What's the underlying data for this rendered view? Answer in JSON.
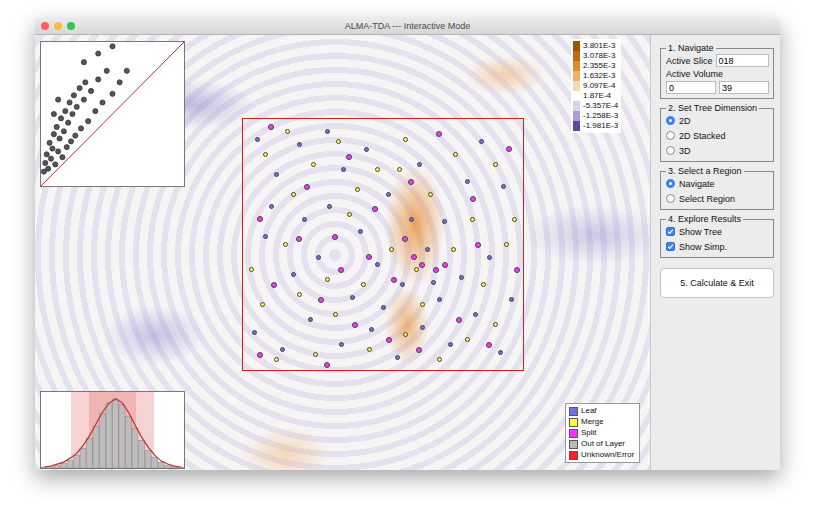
{
  "window": {
    "title": "ALMA-TDA --- Interactive Mode"
  },
  "colorbar": {
    "ticks": [
      {
        "label": "3.801E-3",
        "color": "#a0500a"
      },
      {
        "label": "3.078E-3",
        "color": "#c46a14"
      },
      {
        "label": "2.355E-3",
        "color": "#e08a30"
      },
      {
        "label": "1.632E-3",
        "color": "#f0b070"
      },
      {
        "label": "9.097E-4",
        "color": "#f8d8b0"
      },
      {
        "label": "1.87E-4",
        "color": "#ffffff"
      },
      {
        "label": "-5.357E-4",
        "color": "#d8d4ec"
      },
      {
        "label": "-1.258E-3",
        "color": "#a8a0d4"
      },
      {
        "label": "-1.981E-3",
        "color": "#5a4a98"
      }
    ]
  },
  "legend": [
    {
      "label": "Leaf",
      "kind": "leaf",
      "color": "#7070e8"
    },
    {
      "label": "Merge",
      "kind": "merge",
      "color": "#ffff33"
    },
    {
      "label": "Split",
      "kind": "split",
      "color": "#ff33ff"
    },
    {
      "label": "Out of Layer",
      "kind": "out",
      "color": "#bbbbbb"
    },
    {
      "label": "Unknown/Error",
      "kind": "error",
      "color": "#ff2222"
    }
  ],
  "persistence_diagram": {
    "points": [
      [
        0.02,
        0.1
      ],
      [
        0.03,
        0.16
      ],
      [
        0.04,
        0.22
      ],
      [
        0.05,
        0.12
      ],
      [
        0.06,
        0.3
      ],
      [
        0.07,
        0.19
      ],
      [
        0.08,
        0.26
      ],
      [
        0.09,
        0.36
      ],
      [
        0.1,
        0.15
      ],
      [
        0.11,
        0.41
      ],
      [
        0.12,
        0.24
      ],
      [
        0.13,
        0.33
      ],
      [
        0.14,
        0.47
      ],
      [
        0.15,
        0.2
      ],
      [
        0.16,
        0.38
      ],
      [
        0.17,
        0.52
      ],
      [
        0.18,
        0.27
      ],
      [
        0.19,
        0.44
      ],
      [
        0.2,
        0.58
      ],
      [
        0.21,
        0.31
      ],
      [
        0.22,
        0.5
      ],
      [
        0.23,
        0.63
      ],
      [
        0.24,
        0.35
      ],
      [
        0.25,
        0.55
      ],
      [
        0.27,
        0.68
      ],
      [
        0.28,
        0.4
      ],
      [
        0.3,
        0.6
      ],
      [
        0.31,
        0.72
      ],
      [
        0.33,
        0.45
      ],
      [
        0.35,
        0.66
      ],
      [
        0.38,
        0.52
      ],
      [
        0.4,
        0.74
      ],
      [
        0.43,
        0.58
      ],
      [
        0.46,
        0.8
      ],
      [
        0.5,
        0.64
      ],
      [
        0.55,
        0.72
      ],
      [
        0.6,
        0.8
      ],
      [
        0.4,
        0.92
      ],
      [
        0.3,
        0.86
      ],
      [
        0.5,
        0.97
      ],
      [
        0.12,
        0.6
      ],
      [
        0.09,
        0.5
      ]
    ]
  },
  "histogram": {
    "bars": [
      1,
      2,
      3,
      5,
      8,
      13,
      20,
      30,
      42,
      55,
      66,
      70,
      64,
      52,
      40,
      28,
      18,
      11,
      6,
      3,
      2,
      1
    ],
    "curve": [
      1,
      2,
      4,
      6,
      10,
      15,
      23,
      33,
      45,
      57,
      66,
      70,
      66,
      56,
      43,
      31,
      21,
      13,
      7,
      4,
      2,
      1
    ]
  },
  "region": {
    "critical_points": [
      {
        "kind": "leaf",
        "points": [
          [
            0.05,
            0.08
          ],
          [
            0.12,
            0.22
          ],
          [
            0.2,
            0.1
          ],
          [
            0.31,
            0.35
          ],
          [
            0.44,
            0.12
          ],
          [
            0.52,
            0.3
          ],
          [
            0.63,
            0.18
          ],
          [
            0.72,
            0.41
          ],
          [
            0.85,
            0.09
          ],
          [
            0.93,
            0.27
          ],
          [
            0.08,
            0.47
          ],
          [
            0.18,
            0.62
          ],
          [
            0.27,
            0.55
          ],
          [
            0.39,
            0.71
          ],
          [
            0.48,
            0.58
          ],
          [
            0.57,
            0.66
          ],
          [
            0.66,
            0.52
          ],
          [
            0.78,
            0.63
          ],
          [
            0.88,
            0.55
          ],
          [
            0.96,
            0.72
          ],
          [
            0.04,
            0.85
          ],
          [
            0.14,
            0.92
          ],
          [
            0.24,
            0.8
          ],
          [
            0.35,
            0.9
          ],
          [
            0.46,
            0.84
          ],
          [
            0.55,
            0.95
          ],
          [
            0.64,
            0.83
          ],
          [
            0.74,
            0.9
          ],
          [
            0.83,
            0.78
          ],
          [
            0.92,
            0.93
          ],
          [
            0.1,
            0.35
          ],
          [
            0.36,
            0.2
          ],
          [
            0.6,
            0.4
          ],
          [
            0.8,
            0.25
          ],
          [
            0.42,
            0.45
          ],
          [
            0.7,
            0.72
          ],
          [
            0.22,
            0.4
          ],
          [
            0.5,
            0.75
          ],
          [
            0.68,
            0.65
          ],
          [
            0.3,
            0.05
          ]
        ]
      },
      {
        "kind": "merge",
        "points": [
          [
            0.08,
            0.14
          ],
          [
            0.16,
            0.05
          ],
          [
            0.25,
            0.18
          ],
          [
            0.34,
            0.09
          ],
          [
            0.41,
            0.28
          ],
          [
            0.58,
            0.08
          ],
          [
            0.67,
            0.3
          ],
          [
            0.76,
            0.14
          ],
          [
            0.9,
            0.18
          ],
          [
            0.97,
            0.4
          ],
          [
            0.03,
            0.6
          ],
          [
            0.15,
            0.5
          ],
          [
            0.3,
            0.64
          ],
          [
            0.43,
            0.66
          ],
          [
            0.53,
            0.52
          ],
          [
            0.62,
            0.6
          ],
          [
            0.75,
            0.52
          ],
          [
            0.86,
            0.66
          ],
          [
            0.94,
            0.5
          ],
          [
            0.07,
            0.74
          ],
          [
            0.2,
            0.7
          ],
          [
            0.33,
            0.78
          ],
          [
            0.45,
            0.92
          ],
          [
            0.58,
            0.86
          ],
          [
            0.7,
            0.96
          ],
          [
            0.8,
            0.88
          ],
          [
            0.9,
            0.82
          ],
          [
            0.12,
            0.96
          ],
          [
            0.26,
            0.94
          ],
          [
            0.38,
            0.38
          ],
          [
            0.56,
            0.2
          ],
          [
            0.82,
            0.4
          ],
          [
            0.64,
            0.74
          ],
          [
            0.18,
            0.3
          ],
          [
            0.48,
            0.2
          ]
        ]
      },
      {
        "kind": "split",
        "points": [
          [
            0.1,
            0.03
          ],
          [
            0.23,
            0.27
          ],
          [
            0.38,
            0.15
          ],
          [
            0.47,
            0.36
          ],
          [
            0.6,
            0.25
          ],
          [
            0.7,
            0.06
          ],
          [
            0.82,
            0.32
          ],
          [
            0.95,
            0.12
          ],
          [
            0.06,
            0.4
          ],
          [
            0.2,
            0.48
          ],
          [
            0.33,
            0.47
          ],
          [
            0.45,
            0.55
          ],
          [
            0.58,
            0.48
          ],
          [
            0.72,
            0.58
          ],
          [
            0.84,
            0.5
          ],
          [
            0.98,
            0.6
          ],
          [
            0.11,
            0.66
          ],
          [
            0.28,
            0.72
          ],
          [
            0.4,
            0.82
          ],
          [
            0.52,
            0.88
          ],
          [
            0.63,
            0.92
          ],
          [
            0.77,
            0.8
          ],
          [
            0.88,
            0.9
          ],
          [
            0.06,
            0.94
          ],
          [
            0.3,
            0.98
          ],
          [
            0.61,
            0.55
          ],
          [
            0.64,
            0.58
          ],
          [
            0.69,
            0.6
          ],
          [
            0.54,
            0.64
          ],
          [
            0.35,
            0.6
          ]
        ]
      }
    ]
  },
  "panel": {
    "navigate": {
      "title": "1. Navigate",
      "slice_label": "Active Slice",
      "slice_value": "018",
      "volume_label": "Active Volume",
      "volume_from": "0",
      "volume_to": "39"
    },
    "tree_dimension": {
      "title": "2. Set Tree Dimension",
      "options": [
        {
          "label": "2D",
          "selected": true
        },
        {
          "label": "2D Stacked",
          "selected": false
        },
        {
          "label": "3D",
          "selected": false
        }
      ]
    },
    "region_mode": {
      "title": "3. Select a Region",
      "options": [
        {
          "label": "Navigate",
          "selected": true
        },
        {
          "label": "Select Region",
          "selected": false
        }
      ]
    },
    "explore": {
      "title": "4. Explore Results",
      "options": [
        {
          "label": "Show Tree",
          "checked": true
        },
        {
          "label": "Show Simp.",
          "checked": true
        }
      ]
    },
    "button": "5. Calculate & Exit"
  }
}
